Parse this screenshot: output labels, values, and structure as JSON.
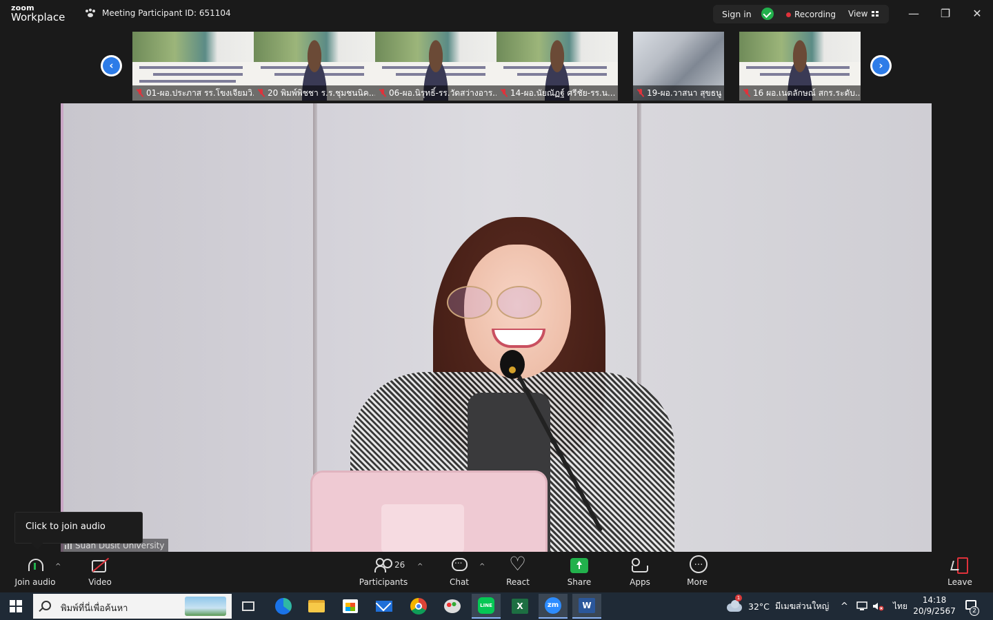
{
  "app": {
    "logo_top": "zoom",
    "logo_bottom": "Workplace",
    "meeting_info": "Meeting Participant ID: 651104",
    "sign_in": "Sign in",
    "recording": "Recording",
    "view": "View",
    "minimize": "—",
    "restore": "❐",
    "close": "✕"
  },
  "thumbnails": [
    {
      "name": "01-ผอ.ประภาส รร.โขงเจียมวิ...",
      "type": "slide"
    },
    {
      "name": "20 พิมพ์พิชชา ร.ร.ชุมชนนิค...",
      "type": "person"
    },
    {
      "name": "06-ผอ.นิรุทธิ์-รร.วัดสว่างอาร...",
      "type": "person"
    },
    {
      "name": "14-ผอ.นัยณัฏฐ์ ศรีชัย-รร.น...",
      "type": "person"
    },
    {
      "name": "19-ผอ.วาสนา สุขธนู",
      "type": "camera"
    },
    {
      "name": "16 ผอ.เนตลักษณ์ สกร.ระดับ...",
      "type": "person"
    }
  ],
  "nav": {
    "prev": "‹",
    "next": "›"
  },
  "main_video": {
    "speaker_label": "Suan Dusit University"
  },
  "tooltip": {
    "text": "Click to join audio"
  },
  "toolbar": {
    "join_audio": "Join audio",
    "video": "Video",
    "participants": "Participants",
    "participants_count": "26",
    "chat": "Chat",
    "react": "React",
    "share": "Share",
    "apps": "Apps",
    "more": "More",
    "leave": "Leave",
    "caret": "^"
  },
  "taskbar": {
    "search_placeholder": "พิมพ์ที่นี่เพื่อค้นหา",
    "apps": [
      "task-view",
      "edge",
      "file-explorer",
      "store",
      "mail",
      "chrome",
      "paint",
      "line",
      "excel",
      "zoom",
      "word"
    ],
    "line_label": "LINE",
    "excel_label": "X",
    "zoom_label": "zm",
    "word_label": "W",
    "weather_badge": "1",
    "temperature": "32°C",
    "weather_text": "มีเมฆส่วนใหญ่",
    "tray_caret": "^",
    "lang": "ไทย",
    "time": "14:18",
    "date": "20/9/2567",
    "notif_count": "2"
  },
  "colors": {
    "accent_blue": "#2d7ce8",
    "share_green": "#22b14c",
    "record_red": "#e0323b",
    "bar_bg": "#1a1a1a"
  }
}
